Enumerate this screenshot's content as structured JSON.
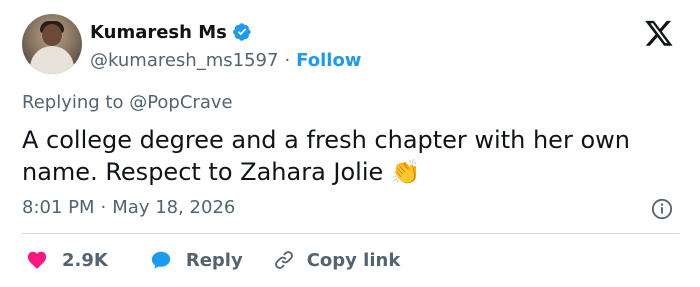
{
  "author": {
    "display_name": "Kumaresh Ms",
    "handle": "@kumaresh_ms1597",
    "follow_label": "Follow",
    "verified": true
  },
  "reply_context": "Replying to @PopCrave",
  "tweet": {
    "text": "A college degree and a fresh chapter with her own name. Respect to Zahara Jolie",
    "emoji": "👏"
  },
  "meta": {
    "time": "8:01 PM",
    "separator": "·",
    "date": "May 18, 2026"
  },
  "actions": {
    "like_count": "2.9K",
    "reply_label": "Reply",
    "copy_label": "Copy link"
  },
  "colors": {
    "accent": "#1d9bf0",
    "like": "#f91880",
    "muted": "#536471",
    "text": "#0f1419"
  },
  "icons": [
    "verified-badge-icon",
    "x-logo-icon",
    "info-icon",
    "heart-icon",
    "reply-bubble-icon",
    "link-icon"
  ]
}
